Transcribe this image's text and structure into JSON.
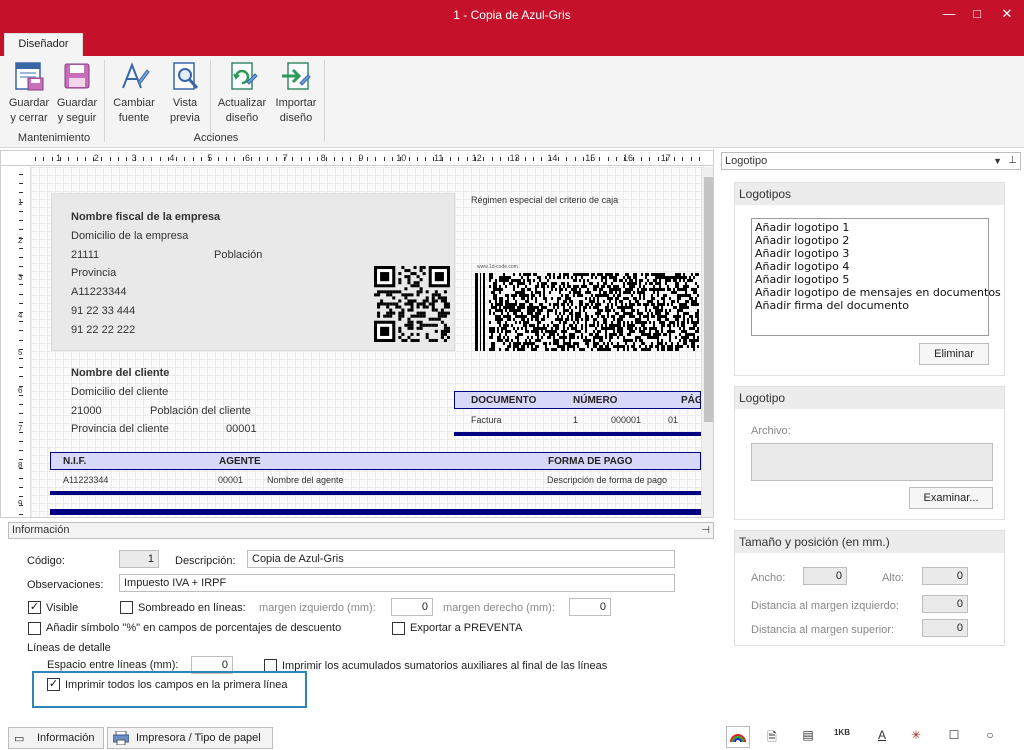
{
  "window": {
    "title": "1 - Copia de Azul-Gris",
    "minimize": "—",
    "maximize": "□",
    "close": "✕"
  },
  "ribbon": {
    "tab": "Diseñador",
    "buttons": {
      "guardar_cerrar": {
        "line1": "Guardar",
        "line2": "y cerrar"
      },
      "guardar_seguir": {
        "line1": "Guardar",
        "line2": "y seguir"
      },
      "cambiar_fuente": {
        "line1": "Cambiar",
        "line2": "fuente"
      },
      "vista_previa": {
        "line1": "Vista",
        "line2": "previa"
      },
      "actualizar_diseno": {
        "line1": "Actualizar",
        "line2": "diseño"
      },
      "importar_diseno": {
        "line1": "Importar",
        "line2": "diseño"
      }
    },
    "groups": {
      "mantenimiento": "Mantenimiento",
      "acciones": "Acciones"
    }
  },
  "ruler": {
    "marks": [
      "1",
      "2",
      "3",
      "4",
      "5",
      "6",
      "7",
      "8",
      "9",
      "10",
      "11",
      "12",
      "13",
      "14",
      "15",
      "16",
      "17"
    ],
    "vmarks": [
      "1",
      "2",
      "3",
      "4",
      "5",
      "6",
      "7",
      "8",
      "9"
    ]
  },
  "document": {
    "regimen": "Régimen especial del criterio de caja",
    "empresa": {
      "nombre": "Nombre fiscal de la empresa",
      "domicilio": "Domicilio de la empresa",
      "cp": "21111",
      "poblacion": "Población",
      "provincia": "Provincia",
      "nif": "A11223344",
      "tel1": "91 22 33 444",
      "tel2": "91 22 22 222"
    },
    "barcode_caption": "www.1d-code.com",
    "cliente": {
      "nombre": "Nombre del cliente",
      "domicilio": "Domicilio del cliente",
      "cp": "21000",
      "poblacion": "Población del cliente",
      "provincia": "Provincia del cliente",
      "codigo": "00001"
    },
    "doc_header": {
      "documento": "DOCUMENTO",
      "numero": "NÚMERO",
      "pagina": "PÁGINA"
    },
    "doc_row": {
      "documento": "Factura",
      "serie": "1",
      "numero": "000001",
      "pagina": "01"
    },
    "nif_header": {
      "nif": "N.I.F.",
      "agente": "AGENTE",
      "forma_pago": "FORMA DE PAGO"
    },
    "nif_row": {
      "nif": "A11223344",
      "agente_cod": "00001",
      "agente_nombre": "Nombre del agente",
      "forma_pago": "Descripción de forma de pago"
    }
  },
  "info_section": {
    "title": "Información",
    "codigo_label": "Código:",
    "codigo_value": "1",
    "descripcion_label": "Descripción:",
    "descripcion_value": "Copia de Azul-Gris",
    "observaciones_label": "Observaciones:",
    "observaciones_value": "Impuesto IVA + IRPF",
    "visible_label": "Visible",
    "visible_checked": true,
    "sombreado_label": "Sombreado en líneas:",
    "margen_izq_label": "margen izquierdo (mm):",
    "margen_izq_value": "0",
    "margen_der_label": "margen derecho (mm):",
    "margen_der_value": "0",
    "simbolo_label": "Añadir símbolo \"%\" en campos de porcentajes de descuento",
    "exportar_label": "Exportar a PREVENTA",
    "lineas_detalle_label": "Líneas de detalle",
    "espacio_label": "Espacio entre líneas (mm):",
    "espacio_value": "0",
    "acumulados_label": "Imprimir los acumulados sumatorios auxiliares al final de las líneas",
    "imprimir_todos_label": "Imprimir todos los campos en la primera línea",
    "imprimir_todos_checked": true,
    "check_mark": "✓"
  },
  "bottom_tabs": {
    "informacion": "Información",
    "impresora": "Impresora / Tipo de papel"
  },
  "right_panel": {
    "dropdown": "Logotipo",
    "pin": "⊥",
    "logotipos": {
      "title": "Logotipos",
      "items": [
        "Añadir logotipo 1",
        "Añadir logotipo 2",
        "Añadir logotipo 3",
        "Añadir logotipo 4",
        "Añadir logotipo 5",
        "Añadir logotipo de mensajes en documentos",
        "Añadir firma del documento"
      ],
      "eliminar": "Eliminar"
    },
    "logotipo": {
      "title": "Logotipo",
      "archivo_label": "Archivo:",
      "examinar": "Examinar..."
    },
    "tamano": {
      "title": "Tamaño y posición (en mm.)",
      "ancho_label": "Ancho:",
      "ancho_value": "0",
      "alto_label": "Alto:",
      "alto_value": "0",
      "dist_izq_label": "Distancia al margen izquierdo:",
      "dist_izq_value": "0",
      "dist_sup_label": "Distancia al margen superior:",
      "dist_sup_value": "0"
    }
  },
  "status_icons": {
    "barcode_label": "1KB",
    "text_icon": "A"
  },
  "colors": {
    "accent": "#c5122a",
    "header_fill": "#d8d8f8",
    "navy": "#000080",
    "highlight": "#2e86b4"
  }
}
